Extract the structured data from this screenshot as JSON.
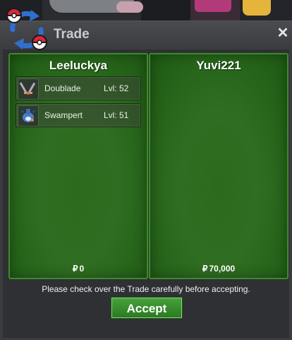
{
  "window": {
    "title": "Trade",
    "close_symbol": "✕"
  },
  "left_trader": {
    "name": "Leeluckya",
    "pokemon": [
      {
        "name": "Doublade",
        "level": "Lvl: 52",
        "icon": "doublade-icon"
      },
      {
        "name": "Swampert",
        "level": "Lvl: 51",
        "icon": "swampert-icon"
      }
    ],
    "money_symbol": "₽",
    "money": "0"
  },
  "right_trader": {
    "name": "Yuvi221",
    "pokemon": [],
    "money_symbol": "₽",
    "money": "70,000"
  },
  "notice": "Please check over the Trade carefully before accepting.",
  "accept_label": "Accept",
  "colors": {
    "panel_green": "#2f6e22",
    "panel_border": "#3d8a2c",
    "window_bg": "#3b3c40",
    "accept_green": "#3a8f2e",
    "pokeball_red": "#d8283a",
    "arrow_blue": "#2f6fd0"
  }
}
